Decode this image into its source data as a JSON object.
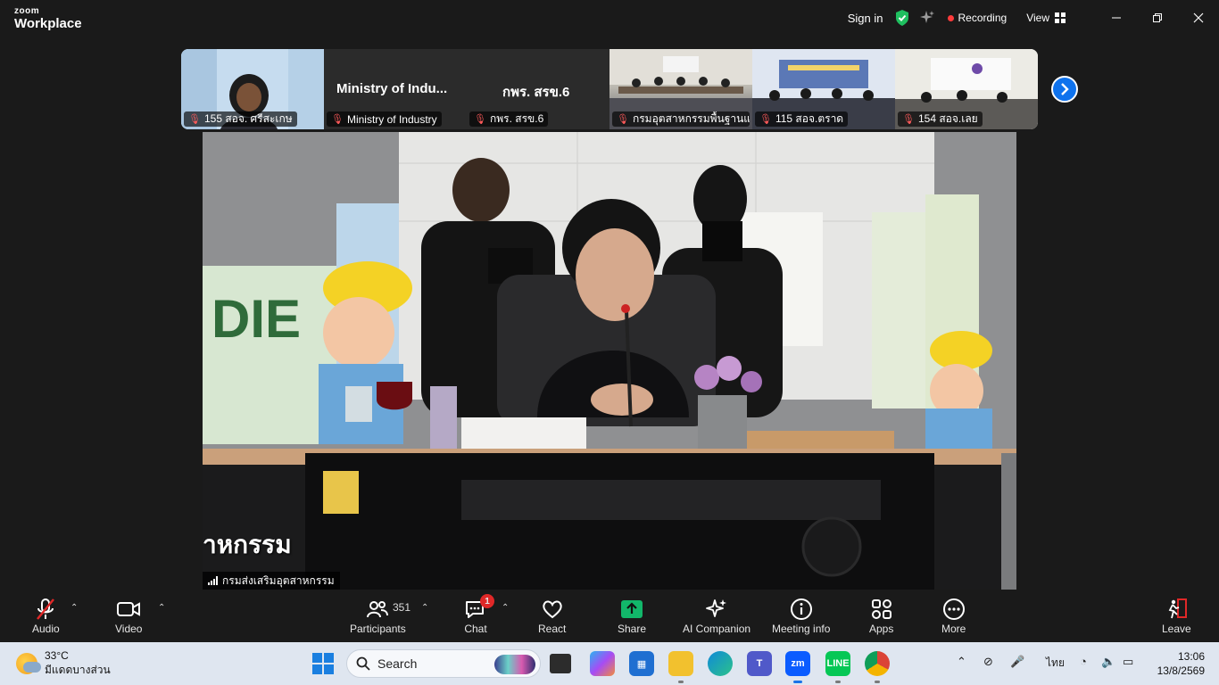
{
  "titlebar": {
    "logo_top": "zoom",
    "logo_bottom": "Workplace",
    "sign_in": "Sign in",
    "recording": "Recording",
    "view": "View"
  },
  "participants_strip": [
    {
      "name": "155 สอจ. ศรีสะเกษ"
    },
    {
      "name": "Ministry of Industry",
      "display": "Ministry of Indu..."
    },
    {
      "name": "กพร. สรข.6",
      "display": "กพร. สรข.6"
    },
    {
      "name": "กรมอุตสาหกรรมพื้นฐานแ..."
    },
    {
      "name": "115 สอจ.ตราด"
    },
    {
      "name": "154 สอจ.เลย"
    }
  ],
  "main_video": {
    "caption": "าหกรรม",
    "name": "กรมส่งเสริมอุตสาหกรรม"
  },
  "toolbar": {
    "audio": "Audio",
    "video": "Video",
    "participants": "Participants",
    "participant_count": "351",
    "chat": "Chat",
    "chat_badge": "1",
    "react": "React",
    "share": "Share",
    "ai_companion": "AI Companion",
    "meeting_info": "Meeting info",
    "apps": "Apps",
    "more": "More",
    "leave": "Leave",
    "share_color": "#12b76a",
    "leave_color": "#e02828"
  },
  "taskbar": {
    "weather_temp": "33°C",
    "weather_desc": "มีแดดบางส่วน",
    "search_placeholder": "Search",
    "language": "ไทย",
    "time": "13:06",
    "date": "13/8/2569"
  }
}
